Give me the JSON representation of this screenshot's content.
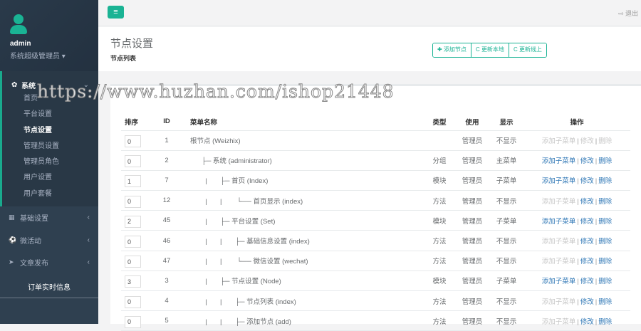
{
  "user": {
    "name": "admin",
    "role": "系统超级管理员 ▾"
  },
  "sidebar": {
    "system": {
      "label": "系统",
      "items": [
        {
          "label": "首页"
        },
        {
          "label": "平台设置"
        },
        {
          "label": "节点设置",
          "active": true
        },
        {
          "label": "管理员设置"
        },
        {
          "label": "管理员角色"
        },
        {
          "label": "用户设置"
        },
        {
          "label": "用户套餐"
        }
      ]
    },
    "menus": [
      {
        "label": "基础设置",
        "icon": "▦"
      },
      {
        "label": "微活动",
        "icon": "⚽"
      },
      {
        "label": "文章发布",
        "icon": "➤"
      }
    ],
    "order_info": "订单实时信息"
  },
  "topbar": {
    "logout": "退出"
  },
  "header": {
    "title": "节点设置",
    "subtitle": "节点列表",
    "buttons": [
      "✚ 添加节点",
      "C 更新本地",
      "C 更新线上"
    ]
  },
  "table": {
    "headers": [
      "排序",
      "ID",
      "菜单名称",
      "类型",
      "使用",
      "显示",
      "操作"
    ],
    "rows": [
      {
        "order": "0",
        "id": "1",
        "name": "根节点 (Weizhix)",
        "type": "",
        "use": "管理员",
        "show": "不显示",
        "add": false,
        "edit": false,
        "del": false
      },
      {
        "order": "0",
        "id": "2",
        "name": "      ├─ 系统 (administrator)",
        "type": "分组",
        "use": "管理员",
        "show": "主菜单",
        "add": true,
        "edit": true,
        "del": true
      },
      {
        "order": "1",
        "id": "7",
        "name": "        |       ├─ 首页 (Index)",
        "type": "模块",
        "use": "管理员",
        "show": "子菜单",
        "add": true,
        "edit": true,
        "del": true
      },
      {
        "order": "0",
        "id": "12",
        "name": "        |       |        └── 首页显示 (index)",
        "type": "方法",
        "use": "管理员",
        "show": "不显示",
        "add": false,
        "edit": true,
        "del": true
      },
      {
        "order": "2",
        "id": "45",
        "name": "        |       ├─ 平台设置 (Set)",
        "type": "模块",
        "use": "管理员",
        "show": "子菜单",
        "add": true,
        "edit": true,
        "del": true
      },
      {
        "order": "0",
        "id": "46",
        "name": "        |       |       ├─ 基础信息设置 (index)",
        "type": "方法",
        "use": "管理员",
        "show": "不显示",
        "add": false,
        "edit": true,
        "del": true
      },
      {
        "order": "0",
        "id": "47",
        "name": "        |       |        └── 微信设置 (wechat)",
        "type": "方法",
        "use": "管理员",
        "show": "不显示",
        "add": false,
        "edit": true,
        "del": true
      },
      {
        "order": "3",
        "id": "3",
        "name": "        |       ├─ 节点设置 (Node)",
        "type": "模块",
        "use": "管理员",
        "show": "子菜单",
        "add": true,
        "edit": true,
        "del": true
      },
      {
        "order": "0",
        "id": "4",
        "name": "        |       |       ├─ 节点列表 (index)",
        "type": "方法",
        "use": "管理员",
        "show": "不显示",
        "add": false,
        "edit": true,
        "del": true
      },
      {
        "order": "0",
        "id": "5",
        "name": "        |       |       ├─ 添加节点 (add)",
        "type": "方法",
        "use": "管理员",
        "show": "不显示",
        "add": false,
        "edit": true,
        "del": true
      }
    ],
    "actions": {
      "add": "添加子菜单",
      "edit": "修改",
      "del": "删除"
    }
  },
  "watermark": "https://www.huzhan.com/ishop21448"
}
